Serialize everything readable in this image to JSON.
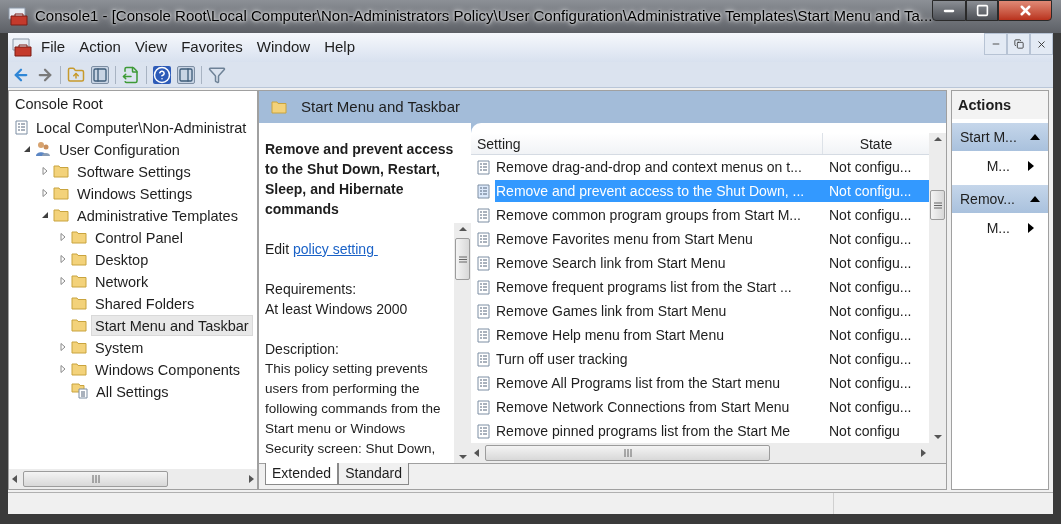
{
  "window": {
    "title": "Console1 - [Console Root\\Local Computer\\Non-Administrators Policy\\User Configuration\\Administrative Templates\\Start Menu and Ta..."
  },
  "menu": [
    "File",
    "Action",
    "View",
    "Favorites",
    "Window",
    "Help"
  ],
  "tree": {
    "root": "Console Root",
    "items": [
      {
        "label": "Local Computer\\Non-Administrat",
        "kind": "policy",
        "selected": false,
        "children": [
          {
            "label": "User Configuration",
            "kind": "user",
            "expanded": true,
            "selected": false,
            "children": [
              {
                "label": "Software Settings",
                "kind": "folder",
                "expanded": false,
                "selected": false
              },
              {
                "label": "Windows Settings",
                "kind": "folder",
                "expanded": false,
                "selected": false
              },
              {
                "label": "Administrative Templates",
                "kind": "folder",
                "expanded": true,
                "selected": false,
                "children": [
                  {
                    "label": "Control Panel",
                    "kind": "folder",
                    "expanded": false,
                    "selected": false
                  },
                  {
                    "label": "Desktop",
                    "kind": "folder",
                    "expanded": false,
                    "selected": false
                  },
                  {
                    "label": "Network",
                    "kind": "folder",
                    "expanded": false,
                    "selected": false
                  },
                  {
                    "label": "Shared Folders",
                    "kind": "folder",
                    "selected": false
                  },
                  {
                    "label": "Start Menu and Taskbar",
                    "kind": "folder",
                    "selected": true
                  },
                  {
                    "label": "System",
                    "kind": "folder",
                    "expanded": false,
                    "selected": false
                  },
                  {
                    "label": "Windows Components",
                    "kind": "folder",
                    "expanded": false,
                    "selected": false
                  },
                  {
                    "label": "All Settings",
                    "kind": "settings",
                    "selected": false
                  }
                ]
              }
            ]
          }
        ]
      }
    ]
  },
  "details": {
    "header": "Start Menu and Taskbar",
    "heading": "Remove and prevent access to the Shut Down, Restart, Sleep, and Hibernate commands",
    "edit_prefix": "Edit",
    "edit_link": "policy setting ",
    "requirements_label": "Requirements:",
    "requirements": "At least Windows 2000",
    "description_label": "Description:",
    "description": "This policy setting prevents users from performing the following commands from the Start menu or Windows Security screen: Shut Down,"
  },
  "table": {
    "columns": [
      "Setting",
      "State"
    ],
    "rows": [
      {
        "setting": "Remove drag-and-drop and context menus on t...",
        "state": "Not configu...",
        "selected": false
      },
      {
        "setting": "Remove and prevent access to the Shut Down, ...",
        "state": "Not configu...",
        "selected": true
      },
      {
        "setting": "Remove common program groups from Start M...",
        "state": "Not configu...",
        "selected": false
      },
      {
        "setting": "Remove Favorites menu from Start Menu",
        "state": "Not configu...",
        "selected": false
      },
      {
        "setting": "Remove Search link from Start Menu",
        "state": "Not configu...",
        "selected": false
      },
      {
        "setting": "Remove frequent programs list from the Start ...",
        "state": "Not configu...",
        "selected": false
      },
      {
        "setting": "Remove Games link from Start Menu",
        "state": "Not configu...",
        "selected": false
      },
      {
        "setting": "Remove Help menu from Start Menu",
        "state": "Not configu...",
        "selected": false
      },
      {
        "setting": "Turn off user tracking",
        "state": "Not configu...",
        "selected": false
      },
      {
        "setting": "Remove All Programs list from the Start menu",
        "state": "Not configu...",
        "selected": false
      },
      {
        "setting": "Remove Network Connections from Start Menu",
        "state": "Not configu...",
        "selected": false
      },
      {
        "setting": "Remove pinned programs list from the Start Me",
        "state": "Not configu",
        "selected": false
      }
    ]
  },
  "bottom_tabs": [
    {
      "label": "Extended",
      "selected": true
    },
    {
      "label": "Standard",
      "selected": false
    }
  ],
  "actions": {
    "title": "Actions",
    "groups": [
      {
        "label": "Start M...",
        "items": [
          "M..."
        ]
      },
      {
        "label": "Remov...",
        "items": [
          "M..."
        ]
      }
    ]
  }
}
